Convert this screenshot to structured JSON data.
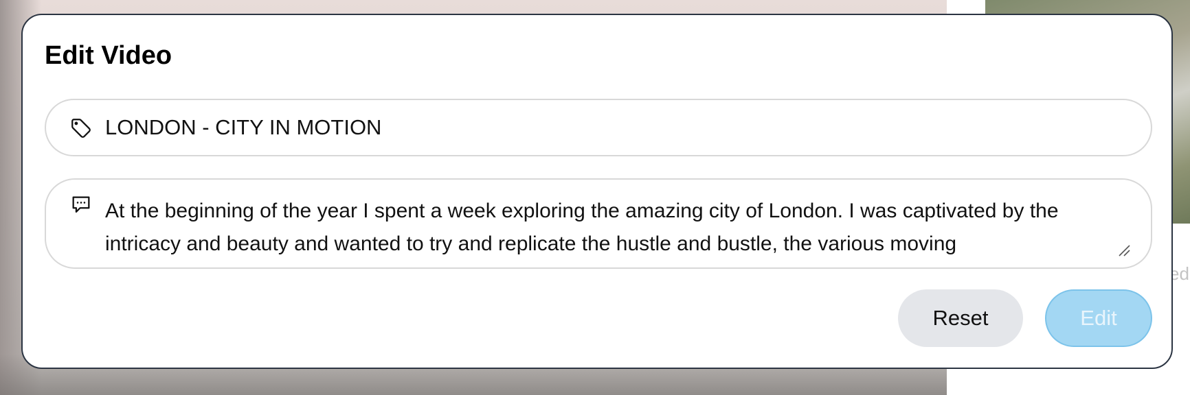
{
  "background": {
    "side_text": "ed"
  },
  "modal": {
    "title": "Edit Video",
    "title_field": {
      "icon": "tag-icon",
      "value": "LONDON - CITY IN MOTION"
    },
    "description_field": {
      "icon": "chat-bubble-icon",
      "value": "At the beginning of the year I spent a week exploring the amazing city of London. I was captivated by the intricacy and beauty and wanted to try and replicate the hustle and bustle, the various moving"
    },
    "buttons": {
      "reset_label": "Reset",
      "edit_label": "Edit"
    }
  },
  "colors": {
    "edit_button_bg": "#a3d7f3",
    "reset_button_bg": "#e4e6ea",
    "modal_border": "#2b3442"
  }
}
